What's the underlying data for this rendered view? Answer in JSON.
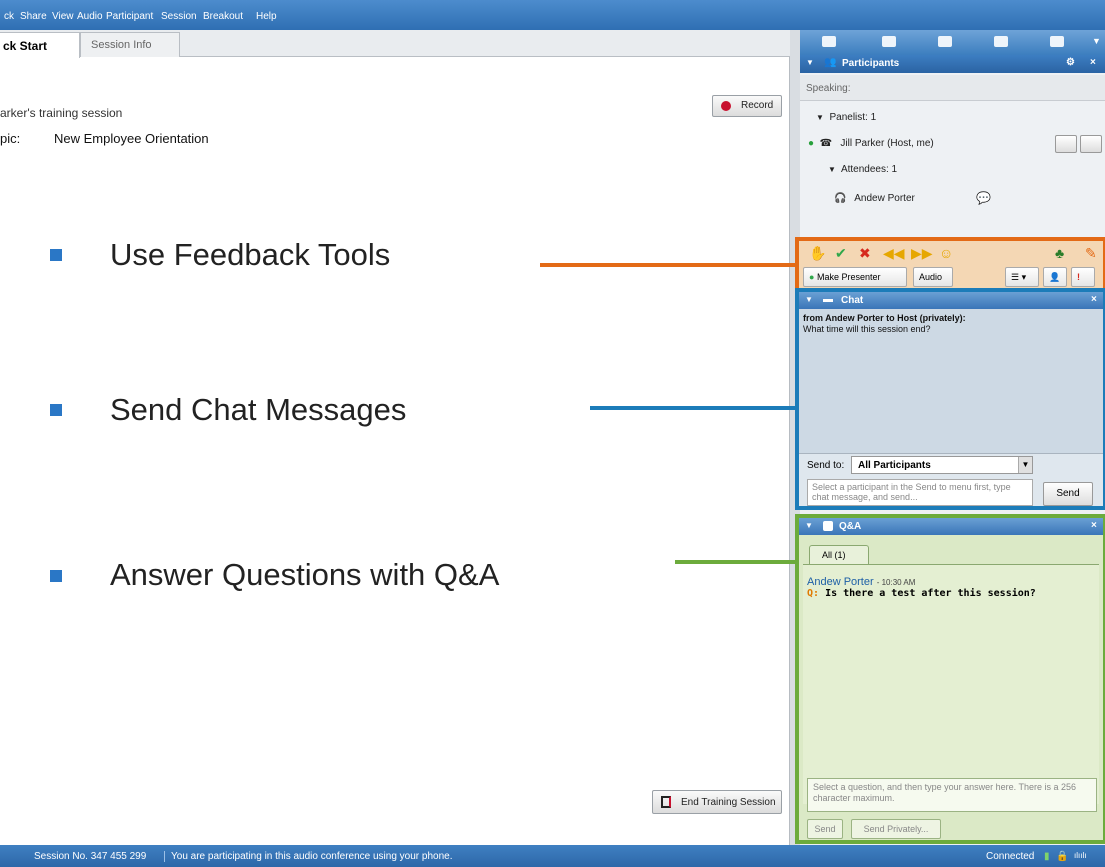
{
  "menu": [
    "ck",
    "Share",
    "View",
    "Audio",
    "Participant",
    "Session",
    "Breakout",
    "Help"
  ],
  "tabs": {
    "quick_start": "ck Start",
    "session_info": "Session Info"
  },
  "session": {
    "host_line": "arker's training session",
    "topic_label": "pic:",
    "topic_value": "New Employee Orientation"
  },
  "buttons": {
    "record": "Record",
    "end_session": "End Training Session"
  },
  "bullets": [
    {
      "text": "Use Feedback Tools",
      "color": "#e36a16"
    },
    {
      "text": "Send Chat Messages",
      "color": "#1c7cb9"
    },
    {
      "text": "Answer Questions with Q&A",
      "color": "#6cab3c"
    }
  ],
  "participants": {
    "title": "Participants",
    "speaking": "Speaking:",
    "panelist_group": "Panelist: 1",
    "host_name": "Jill Parker (Host, me)",
    "attendee_group": "Attendees: 1",
    "attendee_name": "Andew Porter"
  },
  "feedback": {
    "make_presenter": "Make Presenter",
    "audio": "Audio"
  },
  "chat": {
    "title": "Chat",
    "msg_from": "from Andew Porter to Host (privately):",
    "msg_text": "What time will this session end?",
    "send_to_label": "Send to:",
    "send_to_value": "All Participants",
    "input_placeholder": "Select a participant in the Send to menu first, type chat message, and send...",
    "send": "Send"
  },
  "qa": {
    "title": "Q&A",
    "tab": "All (1)",
    "asker": "Andew Porter",
    "time": "- 10:30 AM",
    "q_prefix": "Q:",
    "question": "Is there a test after this session?",
    "answer_placeholder": "Select a question, and then type your answer here. There is a 256 character maximum.",
    "send": "Send",
    "send_privately": "Send Privately..."
  },
  "status": {
    "session_no": "Session No. 347 455 299",
    "audio_msg": "You are participating in this audio conference using your phone.",
    "connected": "Connected"
  }
}
